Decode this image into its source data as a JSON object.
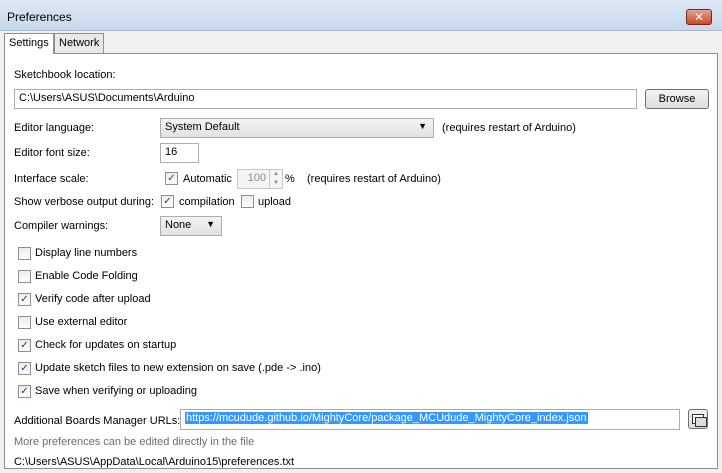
{
  "window": {
    "title": "Preferences",
    "close_label": "✕"
  },
  "tabs": [
    {
      "label": "Settings"
    },
    {
      "label": "Network"
    }
  ],
  "settings": {
    "sketchbook_label": "Sketchbook location:",
    "sketchbook_path": "C:\\Users\\ASUS\\Documents\\Arduino",
    "browse_label": "Browse",
    "editor_language_label": "Editor language:",
    "editor_language_value": "System Default",
    "editor_language_note": "(requires restart of Arduino)",
    "font_size_label": "Editor font size:",
    "font_size_value": "16",
    "interface_scale_label": "Interface scale:",
    "automatic_label": "Automatic",
    "automatic_checked": true,
    "scale_value": "100",
    "percent_sign": "%",
    "interface_scale_note": "(requires restart of Arduino)",
    "verbose_label": "Show verbose output during:",
    "verbose_compilation_label": "compilation",
    "verbose_compilation_checked": true,
    "verbose_upload_label": "upload",
    "verbose_upload_checked": false,
    "compiler_warnings_label": "Compiler warnings:",
    "compiler_warnings_value": "None",
    "options": [
      {
        "label": "Display line numbers",
        "checked": false
      },
      {
        "label": "Enable Code Folding",
        "checked": false
      },
      {
        "label": "Verify code after upload",
        "checked": true
      },
      {
        "label": "Use external editor",
        "checked": false
      },
      {
        "label": "Check for updates on startup",
        "checked": true
      },
      {
        "label": "Update sketch files to new extension on save (.pde -> .ino)",
        "checked": true
      },
      {
        "label": "Save when verifying or uploading",
        "checked": true
      }
    ],
    "boards_urls_label": "Additional Boards Manager URLs:",
    "boards_urls_value": "https://mcudude.github.io/MightyCore/package_MCUdude_MightyCore_index.json",
    "more_prefs_note": "More preferences can be edited directly in the file",
    "prefs_file_path": "C:\\Users\\ASUS\\AppData\\Local\\Arduino15\\preferences.txt"
  }
}
